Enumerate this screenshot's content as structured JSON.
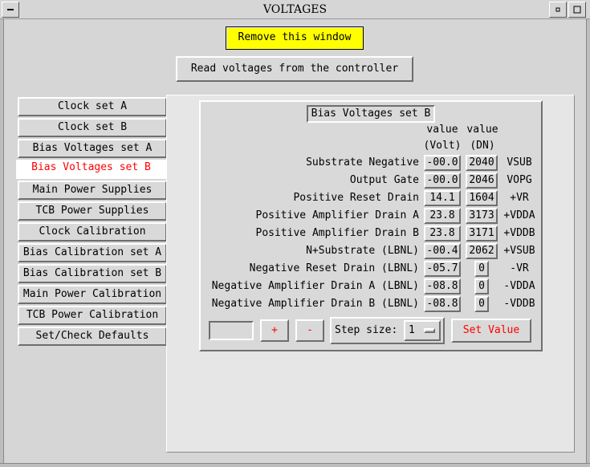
{
  "window": {
    "title": "VOLTAGES",
    "controls": [
      "minimize-icon",
      "restore-icon",
      "close-icon"
    ]
  },
  "actions": {
    "remove_label": "Remove this window",
    "read_label": "Read voltages from the controller"
  },
  "sidebar": {
    "items": [
      {
        "label": "Clock set A",
        "active": false
      },
      {
        "label": "Clock set B",
        "active": false
      },
      {
        "label": "Bias Voltages set A",
        "active": false
      },
      {
        "label": "Bias Voltages set B",
        "active": true
      },
      {
        "label": "Main Power Supplies",
        "active": false
      },
      {
        "label": "TCB Power Supplies",
        "active": false
      },
      {
        "label": "Clock Calibration",
        "active": false
      },
      {
        "label": "Bias Calibration set A",
        "active": false
      },
      {
        "label": "Bias Calibration set B",
        "active": false
      },
      {
        "label": "Main Power Calibration",
        "active": false
      },
      {
        "label": "TCB Power Calibration",
        "active": false
      },
      {
        "label": "Set/Check Defaults",
        "active": false
      }
    ]
  },
  "panel": {
    "title": "Bias Voltages set B",
    "col_volt": {
      "line1": "value",
      "line2": "(Volt)"
    },
    "col_dn": {
      "line1": "value",
      "line2": "(DN)"
    },
    "rows": [
      {
        "label": "Substrate Negative",
        "volt": "-00.0",
        "dn": "2040",
        "signal": "VSUB"
      },
      {
        "label": "Output Gate",
        "volt": "-00.0",
        "dn": "2046",
        "signal": "VOPG"
      },
      {
        "label": "Positive Reset Drain",
        "volt": "14.1",
        "dn": "1604",
        "signal": "+VR"
      },
      {
        "label": "Positive Amplifier Drain A",
        "volt": "23.8",
        "dn": "3173",
        "signal": "+VDDA"
      },
      {
        "label": "Positive Amplifier Drain B",
        "volt": "23.8",
        "dn": "3171",
        "signal": "+VDDB"
      },
      {
        "label": "N+Substrate (LBNL)",
        "volt": "-00.4",
        "dn": "2062",
        "signal": "+VSUB"
      },
      {
        "label": "Negative Reset Drain (LBNL)",
        "volt": "-05.7",
        "dn": "0",
        "signal": "-VR"
      },
      {
        "label": "Negative Amplifier Drain A (LBNL)",
        "volt": "-08.8",
        "dn": "0",
        "signal": "-VDDA"
      },
      {
        "label": "Negative Amplifier Drain B (LBNL)",
        "volt": "-08.8",
        "dn": "0",
        "signal": "-VDDB"
      }
    ],
    "controls": {
      "entry_value": "",
      "plus_label": "+",
      "minus_label": "-",
      "step_label": "Step size:",
      "step_value": "1",
      "set_label": "Set Value"
    }
  },
  "colors": {
    "background": "#d6d6d6",
    "highlight_yellow": "#ffff00",
    "accent_red": "#ff0000",
    "active_tab_bg": "#ffffff"
  }
}
